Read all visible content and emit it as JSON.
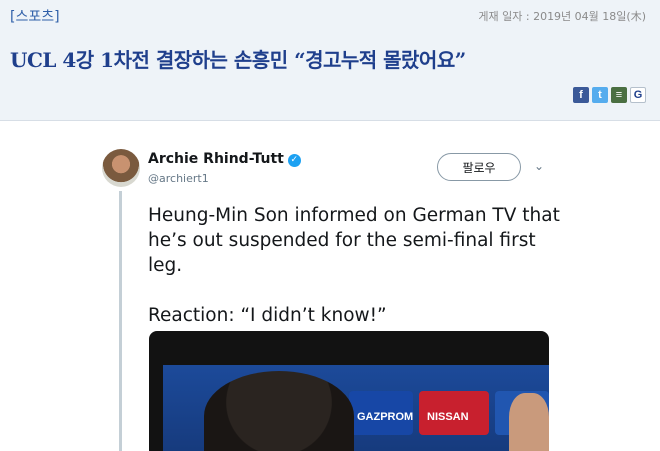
{
  "article": {
    "section": "[스포츠]",
    "date": "게재 일자 : 2019년 04월 18일(木)",
    "title": "UCL 4강 1차전 결장하는 손흥민 “경고누적 몰랐어요”",
    "share_icons": [
      "facebook-icon",
      "twitter-icon",
      "messenger-icon",
      "google-icon"
    ]
  },
  "tweet": {
    "name": "Archie Rhind-Tutt",
    "handle": "@archiert1",
    "follow_label": "팔로우",
    "text": "Heung-Min Son informed on German TV that he’s out suspended for the semi-final first leg.",
    "reaction": "Reaction: “I didn’t know!”",
    "media_ads": [
      "GAZPROM",
      "NISSAN"
    ]
  },
  "colors": {
    "header_bg": "#eef3f8",
    "title": "#1f3f8c",
    "link": "#2f5fa8",
    "verified": "#1da1f2"
  }
}
